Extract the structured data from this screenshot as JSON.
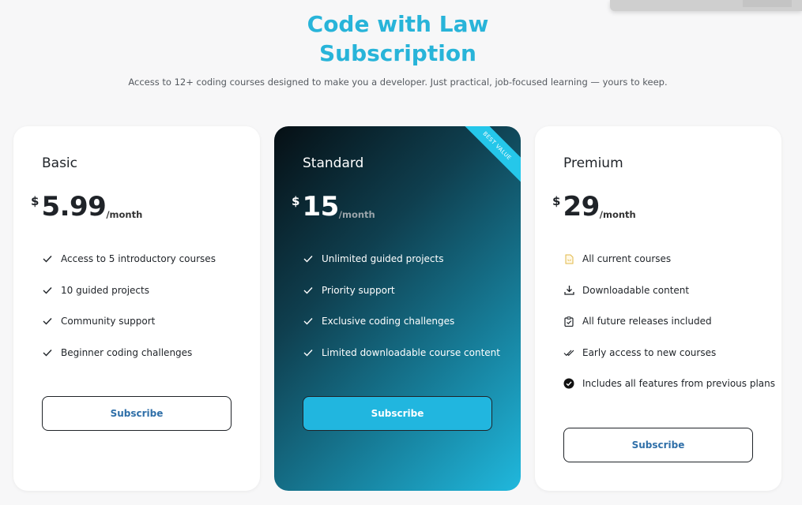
{
  "header": {
    "title_line1": "Code with Law",
    "title_line2": "Subscription",
    "subtitle": "Access to 12+ coding courses designed to make you a developer. Just practical, job-focused learning — yours to keep."
  },
  "plans": [
    {
      "name": "Basic",
      "currency": "$",
      "amount": "5.99",
      "period": "/month",
      "features": [
        {
          "icon": "check-icon",
          "label": "Access to 5 introductory courses"
        },
        {
          "icon": "check-icon",
          "label": "10 guided projects"
        },
        {
          "icon": "check-icon",
          "label": "Community support"
        },
        {
          "icon": "check-icon",
          "label": "Beginner coding challenges"
        }
      ],
      "button": "Subscribe"
    },
    {
      "name": "Standard",
      "ribbon": "BEST VALUE",
      "currency": "$",
      "amount": "15",
      "period": "/month",
      "features": [
        {
          "icon": "check-icon",
          "label": "Unlimited guided projects"
        },
        {
          "icon": "check-icon",
          "label": "Priority support"
        },
        {
          "icon": "check-icon",
          "label": "Exclusive coding challenges"
        },
        {
          "icon": "check-icon",
          "label": "Limited downloadable course content"
        }
      ],
      "button": "Subscribe"
    },
    {
      "name": "Premium",
      "currency": "$",
      "amount": "29",
      "period": "/month",
      "features": [
        {
          "icon": "file-icon",
          "label": "All current courses"
        },
        {
          "icon": "download-icon",
          "label": "Downloadable content"
        },
        {
          "icon": "clipboard-check-icon",
          "label": "All future releases included"
        },
        {
          "icon": "double-check-icon",
          "label": "Early access to new courses"
        },
        {
          "icon": "check-circle-icon",
          "label": "Includes all features from previous plans"
        }
      ],
      "button": "Subscribe"
    }
  ],
  "colors": {
    "accent": "#28b4d9",
    "button_accent": "#21b6df",
    "ribbon": "#25c7ea",
    "background": "#f7f7f8"
  }
}
